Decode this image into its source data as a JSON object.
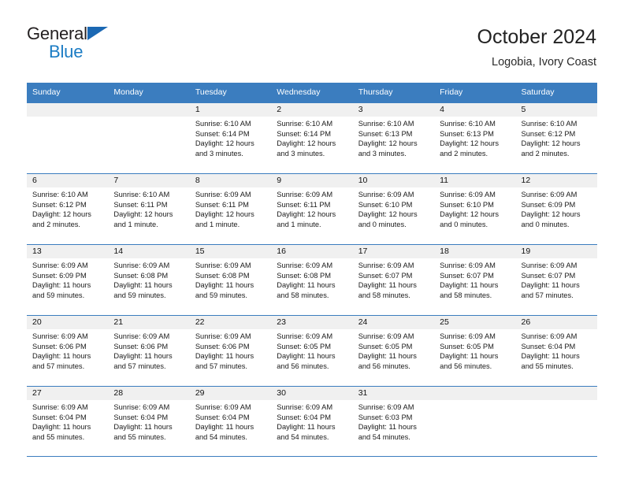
{
  "brand": {
    "word_one": "General",
    "word_two": "Blue",
    "triangle_color": "#1b68b3",
    "word_two_color": "#1b7cc4"
  },
  "header": {
    "title": "October 2024",
    "subtitle": "Logobia, Ivory Coast",
    "accent_color": "#3b7dbf",
    "day_band_color": "#f0f0f0"
  },
  "weekdays": [
    "Sunday",
    "Monday",
    "Tuesday",
    "Wednesday",
    "Thursday",
    "Friday",
    "Saturday"
  ],
  "weeks": [
    {
      "days": [
        {
          "date": "",
          "sunrise": "",
          "sunset": "",
          "daylight_1": "",
          "daylight_2": ""
        },
        {
          "date": "",
          "sunrise": "",
          "sunset": "",
          "daylight_1": "",
          "daylight_2": ""
        },
        {
          "date": "1",
          "sunrise": "Sunrise: 6:10 AM",
          "sunset": "Sunset: 6:14 PM",
          "daylight_1": "Daylight: 12 hours",
          "daylight_2": "and 3 minutes."
        },
        {
          "date": "2",
          "sunrise": "Sunrise: 6:10 AM",
          "sunset": "Sunset: 6:14 PM",
          "daylight_1": "Daylight: 12 hours",
          "daylight_2": "and 3 minutes."
        },
        {
          "date": "3",
          "sunrise": "Sunrise: 6:10 AM",
          "sunset": "Sunset: 6:13 PM",
          "daylight_1": "Daylight: 12 hours",
          "daylight_2": "and 3 minutes."
        },
        {
          "date": "4",
          "sunrise": "Sunrise: 6:10 AM",
          "sunset": "Sunset: 6:13 PM",
          "daylight_1": "Daylight: 12 hours",
          "daylight_2": "and 2 minutes."
        },
        {
          "date": "5",
          "sunrise": "Sunrise: 6:10 AM",
          "sunset": "Sunset: 6:12 PM",
          "daylight_1": "Daylight: 12 hours",
          "daylight_2": "and 2 minutes."
        }
      ]
    },
    {
      "days": [
        {
          "date": "6",
          "sunrise": "Sunrise: 6:10 AM",
          "sunset": "Sunset: 6:12 PM",
          "daylight_1": "Daylight: 12 hours",
          "daylight_2": "and 2 minutes."
        },
        {
          "date": "7",
          "sunrise": "Sunrise: 6:10 AM",
          "sunset": "Sunset: 6:11 PM",
          "daylight_1": "Daylight: 12 hours",
          "daylight_2": "and 1 minute."
        },
        {
          "date": "8",
          "sunrise": "Sunrise: 6:09 AM",
          "sunset": "Sunset: 6:11 PM",
          "daylight_1": "Daylight: 12 hours",
          "daylight_2": "and 1 minute."
        },
        {
          "date": "9",
          "sunrise": "Sunrise: 6:09 AM",
          "sunset": "Sunset: 6:11 PM",
          "daylight_1": "Daylight: 12 hours",
          "daylight_2": "and 1 minute."
        },
        {
          "date": "10",
          "sunrise": "Sunrise: 6:09 AM",
          "sunset": "Sunset: 6:10 PM",
          "daylight_1": "Daylight: 12 hours",
          "daylight_2": "and 0 minutes."
        },
        {
          "date": "11",
          "sunrise": "Sunrise: 6:09 AM",
          "sunset": "Sunset: 6:10 PM",
          "daylight_1": "Daylight: 12 hours",
          "daylight_2": "and 0 minutes."
        },
        {
          "date": "12",
          "sunrise": "Sunrise: 6:09 AM",
          "sunset": "Sunset: 6:09 PM",
          "daylight_1": "Daylight: 12 hours",
          "daylight_2": "and 0 minutes."
        }
      ]
    },
    {
      "days": [
        {
          "date": "13",
          "sunrise": "Sunrise: 6:09 AM",
          "sunset": "Sunset: 6:09 PM",
          "daylight_1": "Daylight: 11 hours",
          "daylight_2": "and 59 minutes."
        },
        {
          "date": "14",
          "sunrise": "Sunrise: 6:09 AM",
          "sunset": "Sunset: 6:08 PM",
          "daylight_1": "Daylight: 11 hours",
          "daylight_2": "and 59 minutes."
        },
        {
          "date": "15",
          "sunrise": "Sunrise: 6:09 AM",
          "sunset": "Sunset: 6:08 PM",
          "daylight_1": "Daylight: 11 hours",
          "daylight_2": "and 59 minutes."
        },
        {
          "date": "16",
          "sunrise": "Sunrise: 6:09 AM",
          "sunset": "Sunset: 6:08 PM",
          "daylight_1": "Daylight: 11 hours",
          "daylight_2": "and 58 minutes."
        },
        {
          "date": "17",
          "sunrise": "Sunrise: 6:09 AM",
          "sunset": "Sunset: 6:07 PM",
          "daylight_1": "Daylight: 11 hours",
          "daylight_2": "and 58 minutes."
        },
        {
          "date": "18",
          "sunrise": "Sunrise: 6:09 AM",
          "sunset": "Sunset: 6:07 PM",
          "daylight_1": "Daylight: 11 hours",
          "daylight_2": "and 58 minutes."
        },
        {
          "date": "19",
          "sunrise": "Sunrise: 6:09 AM",
          "sunset": "Sunset: 6:07 PM",
          "daylight_1": "Daylight: 11 hours",
          "daylight_2": "and 57 minutes."
        }
      ]
    },
    {
      "days": [
        {
          "date": "20",
          "sunrise": "Sunrise: 6:09 AM",
          "sunset": "Sunset: 6:06 PM",
          "daylight_1": "Daylight: 11 hours",
          "daylight_2": "and 57 minutes."
        },
        {
          "date": "21",
          "sunrise": "Sunrise: 6:09 AM",
          "sunset": "Sunset: 6:06 PM",
          "daylight_1": "Daylight: 11 hours",
          "daylight_2": "and 57 minutes."
        },
        {
          "date": "22",
          "sunrise": "Sunrise: 6:09 AM",
          "sunset": "Sunset: 6:06 PM",
          "daylight_1": "Daylight: 11 hours",
          "daylight_2": "and 57 minutes."
        },
        {
          "date": "23",
          "sunrise": "Sunrise: 6:09 AM",
          "sunset": "Sunset: 6:05 PM",
          "daylight_1": "Daylight: 11 hours",
          "daylight_2": "and 56 minutes."
        },
        {
          "date": "24",
          "sunrise": "Sunrise: 6:09 AM",
          "sunset": "Sunset: 6:05 PM",
          "daylight_1": "Daylight: 11 hours",
          "daylight_2": "and 56 minutes."
        },
        {
          "date": "25",
          "sunrise": "Sunrise: 6:09 AM",
          "sunset": "Sunset: 6:05 PM",
          "daylight_1": "Daylight: 11 hours",
          "daylight_2": "and 56 minutes."
        },
        {
          "date": "26",
          "sunrise": "Sunrise: 6:09 AM",
          "sunset": "Sunset: 6:04 PM",
          "daylight_1": "Daylight: 11 hours",
          "daylight_2": "and 55 minutes."
        }
      ]
    },
    {
      "days": [
        {
          "date": "27",
          "sunrise": "Sunrise: 6:09 AM",
          "sunset": "Sunset: 6:04 PM",
          "daylight_1": "Daylight: 11 hours",
          "daylight_2": "and 55 minutes."
        },
        {
          "date": "28",
          "sunrise": "Sunrise: 6:09 AM",
          "sunset": "Sunset: 6:04 PM",
          "daylight_1": "Daylight: 11 hours",
          "daylight_2": "and 55 minutes."
        },
        {
          "date": "29",
          "sunrise": "Sunrise: 6:09 AM",
          "sunset": "Sunset: 6:04 PM",
          "daylight_1": "Daylight: 11 hours",
          "daylight_2": "and 54 minutes."
        },
        {
          "date": "30",
          "sunrise": "Sunrise: 6:09 AM",
          "sunset": "Sunset: 6:04 PM",
          "daylight_1": "Daylight: 11 hours",
          "daylight_2": "and 54 minutes."
        },
        {
          "date": "31",
          "sunrise": "Sunrise: 6:09 AM",
          "sunset": "Sunset: 6:03 PM",
          "daylight_1": "Daylight: 11 hours",
          "daylight_2": "and 54 minutes."
        },
        {
          "date": "",
          "sunrise": "",
          "sunset": "",
          "daylight_1": "",
          "daylight_2": ""
        },
        {
          "date": "",
          "sunrise": "",
          "sunset": "",
          "daylight_1": "",
          "daylight_2": ""
        }
      ]
    }
  ]
}
